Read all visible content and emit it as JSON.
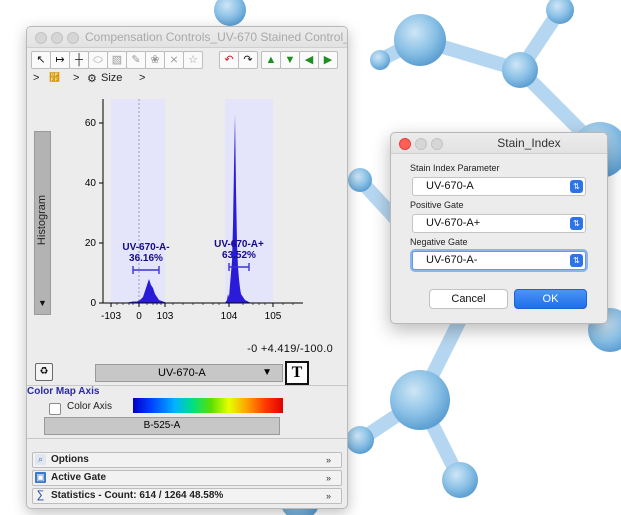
{
  "colors": {
    "accent": "#1f6fe8",
    "gate_fill": "#e4e5fb",
    "histogram": "#1f10d6",
    "label_blue": "#16098a"
  },
  "main_window": {
    "title": "Compensation Controls_UV-670 Stained Control_...",
    "toolbar": {
      "tools": [
        "pointer-icon",
        "range-gate-icon",
        "quad-gate-icon",
        "ellipse-gate-icon",
        "polygon-gate-icon",
        "pencil-icon",
        "spider-icon",
        "freehand-gate-icon",
        "split-gate-icon"
      ],
      "actions": [
        "undo-icon",
        "redo-icon",
        "move-up-icon",
        "move-down-icon",
        "move-left-icon",
        "move-right-icon"
      ]
    },
    "breadcrumb": {
      "sep1": ">",
      "sep2": ">",
      "item": "Size",
      "sep3": ">"
    },
    "side_tab": "Histogram",
    "axis_readout": "-0 +4.419/-100.0",
    "x_param": "UV-670-A",
    "color_map": {
      "title": "Color Map Axis",
      "checkbox_label": "Color Axis",
      "param": "B-525-A"
    },
    "panels": [
      {
        "label": "Options"
      },
      {
        "label": "Active Gate"
      },
      {
        "label": "Statistics  -  Count: 614 / 1264     48.58%"
      }
    ]
  },
  "chart_data": {
    "type": "area",
    "x_scale": "biexponential",
    "x_ticks": [
      "-10^3",
      "0",
      "10^3",
      "10^4",
      "10^5"
    ],
    "y_ticks": [
      0,
      20,
      40,
      60
    ],
    "ylim": [
      0,
      68
    ],
    "gates": [
      {
        "name": "UV-670-A-",
        "percent": "36.16%"
      },
      {
        "name": "UV-670-A+",
        "percent": "63.52%"
      }
    ],
    "histogram": [
      [
        12,
        0
      ],
      [
        22,
        0
      ],
      [
        30,
        0.5
      ],
      [
        34,
        0.5
      ],
      [
        37,
        1
      ],
      [
        40,
        2
      ],
      [
        42,
        4
      ],
      [
        44,
        6
      ],
      [
        46,
        8
      ],
      [
        48,
        6
      ],
      [
        50,
        5
      ],
      [
        52,
        3
      ],
      [
        54,
        2
      ],
      [
        56,
        1
      ],
      [
        60,
        0.5
      ],
      [
        64,
        0
      ],
      [
        122,
        0
      ],
      [
        124,
        1
      ],
      [
        125,
        3
      ],
      [
        126,
        2
      ],
      [
        127,
        6
      ],
      [
        128,
        10
      ],
      [
        129,
        14
      ],
      [
        130,
        26
      ],
      [
        131,
        45
      ],
      [
        132,
        63
      ],
      [
        133,
        38
      ],
      [
        134,
        20
      ],
      [
        135,
        12
      ],
      [
        136,
        8
      ],
      [
        137,
        5
      ],
      [
        138,
        3
      ],
      [
        140,
        2
      ],
      [
        142,
        1
      ],
      [
        145,
        0.5
      ],
      [
        148,
        0
      ],
      [
        188,
        0
      ]
    ]
  },
  "stain_dialog": {
    "title": "Stain_Index",
    "param_label": "Stain Index Parameter",
    "param_value": "UV-670-A",
    "positive_label": "Positive Gate",
    "positive_value": "UV-670-A+",
    "negative_label": "Negative Gate",
    "negative_value": "UV-670-A-",
    "cancel": "Cancel",
    "ok": "OK"
  }
}
